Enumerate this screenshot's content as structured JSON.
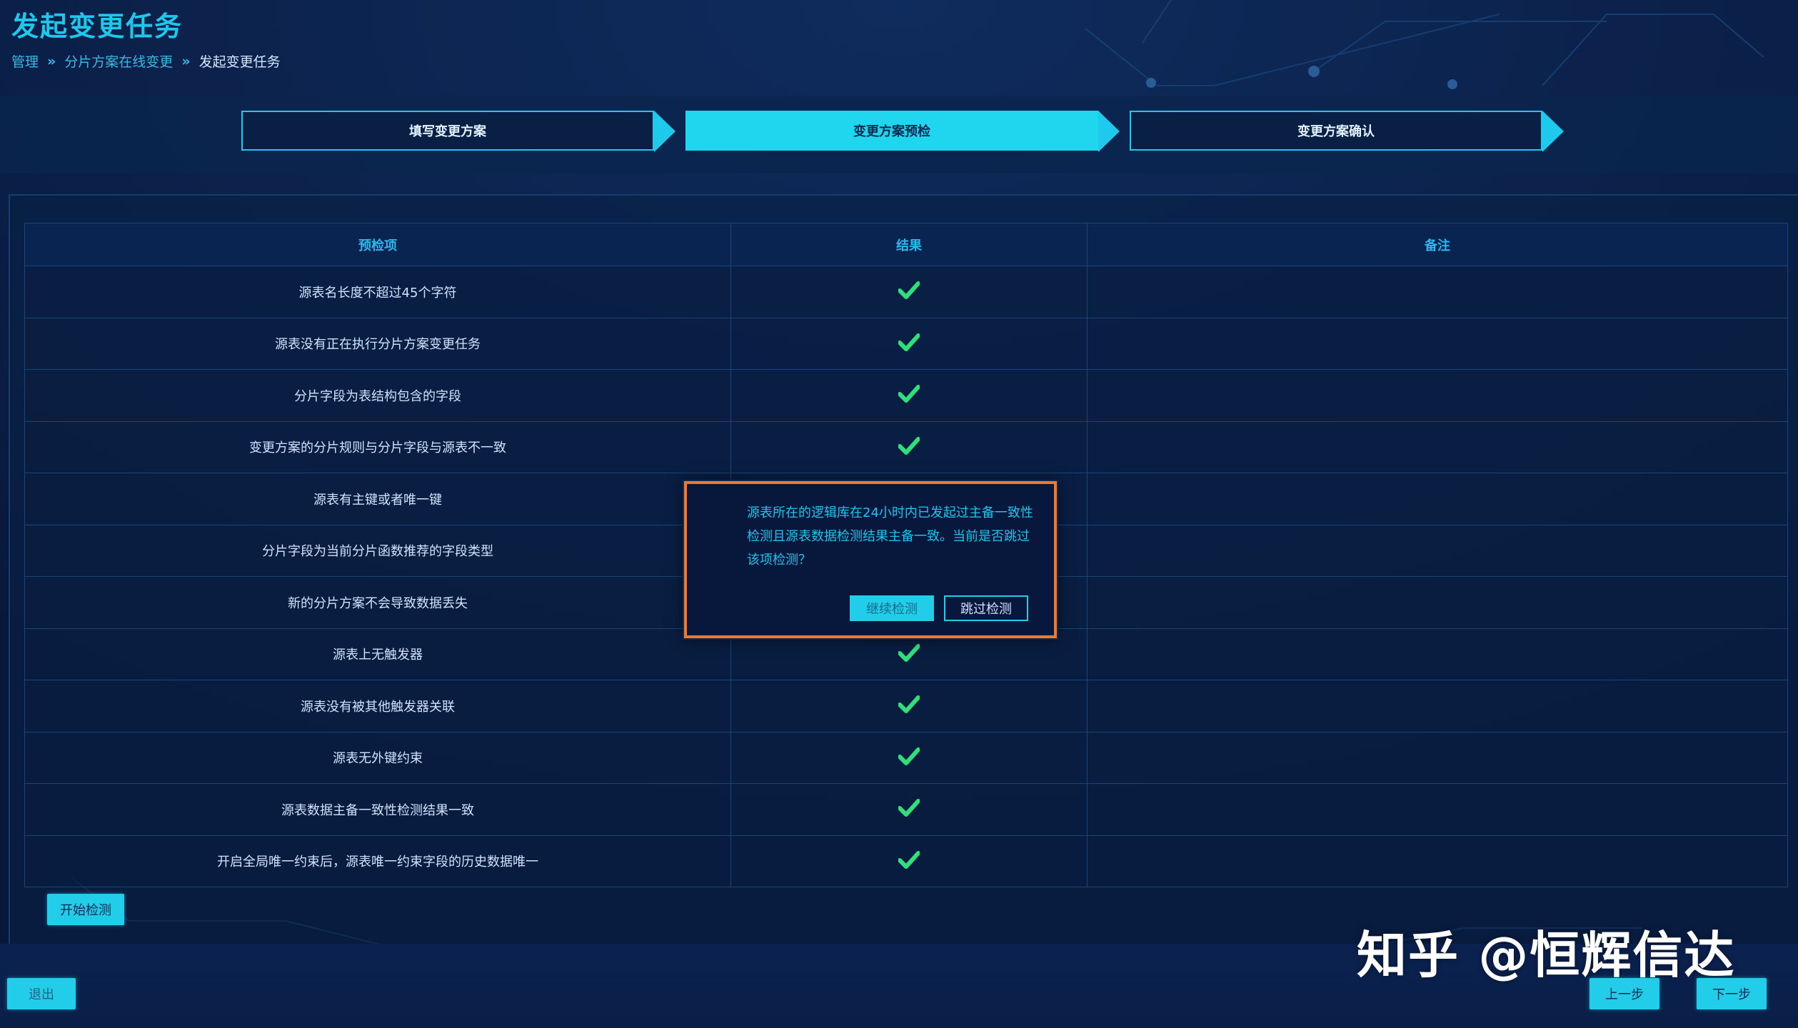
{
  "header": {
    "title": "发起变更任务",
    "breadcrumb": [
      "管理",
      "分片方案在线变更",
      "发起变更任务"
    ],
    "separator": "»"
  },
  "steps": [
    {
      "label": "填写变更方案",
      "active": false
    },
    {
      "label": "变更方案预检",
      "active": true
    },
    {
      "label": "变更方案确认",
      "active": false
    }
  ],
  "table": {
    "columns": [
      "预检项",
      "结果",
      "备注"
    ],
    "rows": [
      {
        "item": "源表名长度不超过45个字符",
        "result": "pass",
        "note": ""
      },
      {
        "item": "源表没有正在执行分片方案变更任务",
        "result": "pass",
        "note": ""
      },
      {
        "item": "分片字段为表结构包含的字段",
        "result": "pass",
        "note": ""
      },
      {
        "item": "变更方案的分片规则与分片字段与源表不一致",
        "result": "pass",
        "note": ""
      },
      {
        "item": "源表有主键或者唯一键",
        "result": "",
        "note": ""
      },
      {
        "item": "分片字段为当前分片函数推荐的字段类型",
        "result": "",
        "note": ""
      },
      {
        "item": "新的分片方案不会导致数据丢失",
        "result": "",
        "note": ""
      },
      {
        "item": "源表上无触发器",
        "result": "pass",
        "note": ""
      },
      {
        "item": "源表没有被其他触发器关联",
        "result": "pass",
        "note": ""
      },
      {
        "item": "源表无外键约束",
        "result": "pass",
        "note": ""
      },
      {
        "item": "源表数据主备一致性检测结果一致",
        "result": "pass",
        "note": ""
      },
      {
        "item": "开启全局唯一约束后，源表唯一约束字段的历史数据唯一",
        "result": "pass",
        "note": ""
      }
    ]
  },
  "dialog": {
    "message": "源表所在的逻辑库在24小时内已发起过主备一致性检测且源表数据检测结果主备一致。当前是否跳过该项检测？",
    "continue_label": "继续检测",
    "skip_label": "跳过检测"
  },
  "buttons": {
    "start": "开始检测",
    "exit": "退出",
    "prev": "上一步",
    "next": "下一步"
  },
  "watermark": "知乎 @恒辉信达",
  "colors": {
    "accent": "#1fd6ee",
    "background": "#08183a",
    "check": "#2fe07a",
    "dialog_border": "#f07a2a"
  },
  "icons": {
    "pass": "check-icon"
  }
}
